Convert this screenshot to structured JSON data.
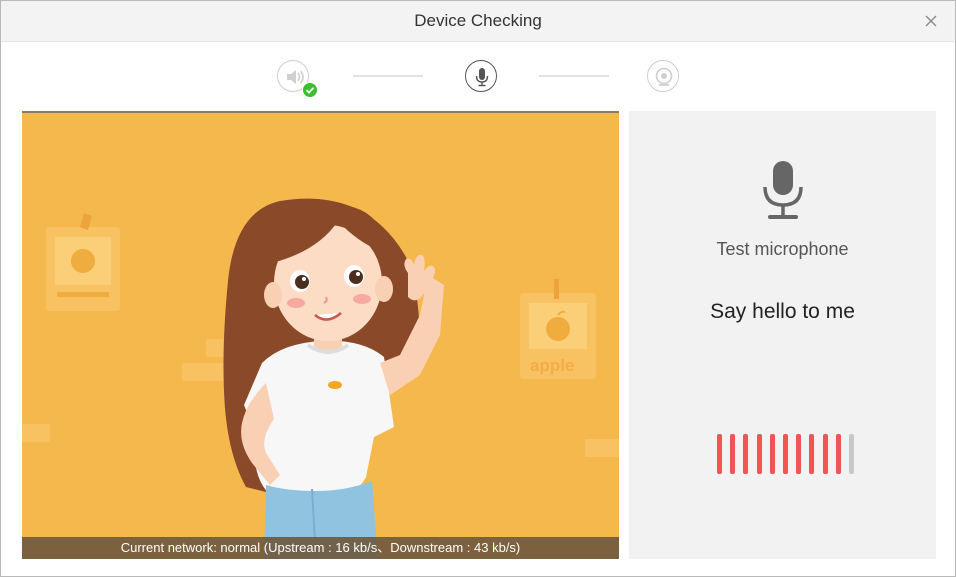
{
  "window": {
    "title": "Device Checking"
  },
  "steps": [
    {
      "name": "speaker",
      "icon": "speaker-icon",
      "state": "done"
    },
    {
      "name": "microphone",
      "icon": "microphone-icon",
      "state": "active"
    },
    {
      "name": "camera",
      "icon": "camera-icon",
      "state": "pending"
    }
  ],
  "video": {
    "network_status": "Current network: normal  (Upstream : 16 kb/s、Downstream : 43 kb/s)",
    "poster_label": "apple"
  },
  "mic_test": {
    "label": "Test microphone",
    "prompt": "Say hello to me",
    "level": {
      "active_bars": 10,
      "total_bars": 11
    }
  },
  "colors": {
    "video_background": "#f5b84c",
    "level_active": "#f05454",
    "level_inactive": "#c8c8c8",
    "check_badge": "#3cbf2e"
  }
}
